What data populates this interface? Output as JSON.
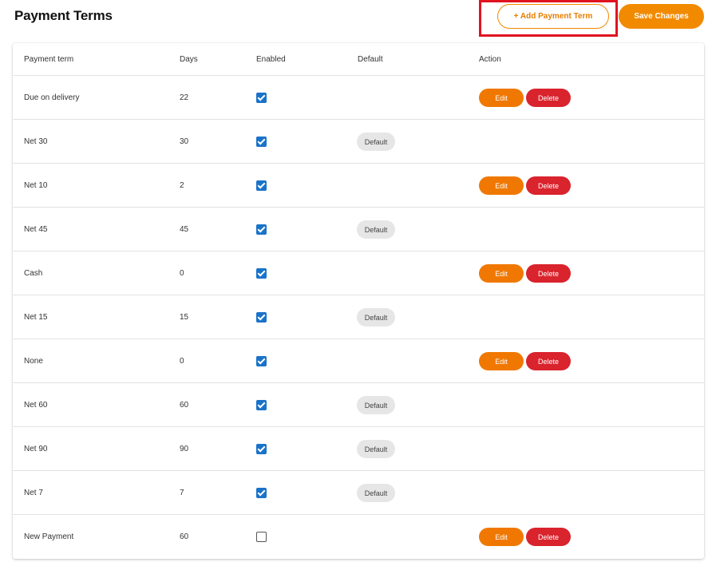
{
  "page": {
    "title": "Payment Terms"
  },
  "toolbar": {
    "add_label": "+ Add Payment Term",
    "save_label": "Save Changes"
  },
  "table": {
    "columns": [
      "Payment term",
      "Days",
      "Enabled",
      "Default",
      "Action"
    ],
    "default_chip_label": "Default",
    "edit_label": "Edit",
    "delete_label": "Delete",
    "rows": [
      {
        "name": "Due on delivery",
        "days": "22",
        "enabled": true,
        "is_default": false
      },
      {
        "name": "Net 30",
        "days": "30",
        "enabled": true,
        "is_default": true
      },
      {
        "name": "Net 10",
        "days": "2",
        "enabled": true,
        "is_default": false
      },
      {
        "name": "Net 45",
        "days": "45",
        "enabled": true,
        "is_default": true
      },
      {
        "name": "Cash",
        "days": "0",
        "enabled": true,
        "is_default": false
      },
      {
        "name": "Net 15",
        "days": "15",
        "enabled": true,
        "is_default": true
      },
      {
        "name": "None",
        "days": "0",
        "enabled": true,
        "is_default": false
      },
      {
        "name": "Net 60",
        "days": "60",
        "enabled": true,
        "is_default": true
      },
      {
        "name": "Net 90",
        "days": "90",
        "enabled": true,
        "is_default": true
      },
      {
        "name": "Net 7",
        "days": "7",
        "enabled": true,
        "is_default": true
      },
      {
        "name": "New Payment",
        "days": "60",
        "enabled": false,
        "is_default": false
      }
    ]
  },
  "colors": {
    "accent": "#f28a00",
    "edit": "#f07800",
    "delete": "#d9232d",
    "checkbox": "#1a73c9",
    "highlight": "#e0131f"
  }
}
